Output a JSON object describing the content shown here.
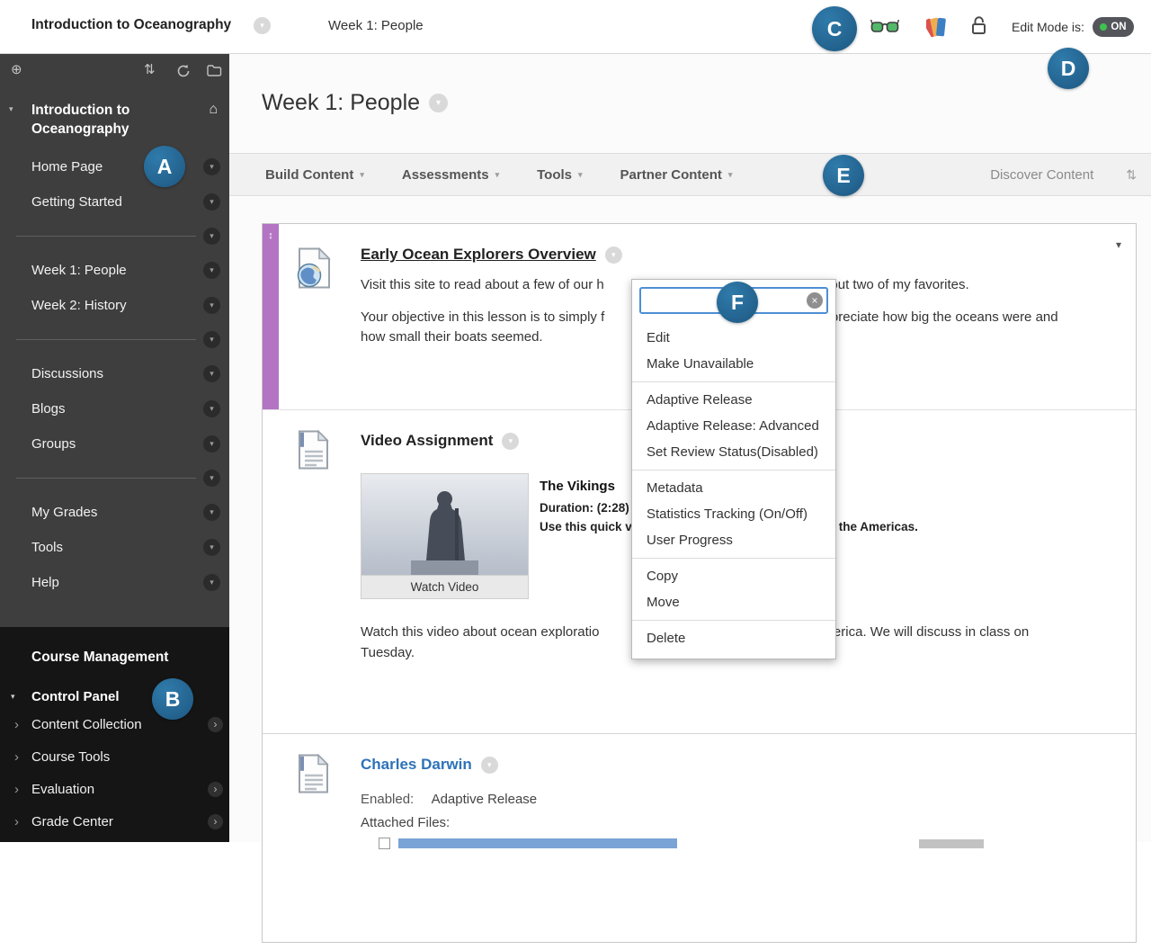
{
  "colors": {
    "annotation_badge": "#26658F",
    "selected_item_strip": "#B474C4",
    "edit_mode_on_green": "#3EC24E",
    "link_blue": "#2D72B8",
    "search_focus_border": "#4D8FD4",
    "sidebar_background": "#3E3E3E",
    "course_management_background": "#151515"
  },
  "icons": {
    "chevron_down": "▾",
    "chevron_right": "›",
    "home": "⌂",
    "move_handle": "↕",
    "add_circle": "⊕",
    "reorder": "⇅",
    "sort": "⇅",
    "clear": "×"
  },
  "annotations": {
    "a": "A",
    "b": "B",
    "c": "C",
    "d": "D",
    "e": "E",
    "f": "F"
  },
  "header": {
    "course_title": "Introduction to Oceanography",
    "breadcrumb": "Week 1: People",
    "edit_mode_label": "Edit Mode is:",
    "edit_mode_value": "ON"
  },
  "sidebar": {
    "course_title_line1": "Introduction to",
    "course_title_line2": "Oceanography",
    "items": [
      "Home Page",
      "Getting Started",
      "Week 1: People",
      "Week 2: History",
      "Discussions",
      "Blogs",
      "Groups",
      "My Grades",
      "Tools",
      "Help"
    ],
    "course_management": {
      "heading": "Course Management",
      "control_panel": "Control Panel",
      "items": [
        "Content Collection",
        "Course Tools",
        "Evaluation",
        "Grade Center"
      ]
    }
  },
  "main": {
    "page_title": "Week 1: People",
    "action_bar": {
      "menus": [
        "Build Content",
        "Assessments",
        "Tools",
        "Partner Content"
      ],
      "discover": "Discover Content"
    },
    "items": {
      "explorers": {
        "title": "Early Ocean Explorers Overview",
        "p1_left": "Visit this site to read about a few of our h",
        "p1_right": "about two of my favorites.",
        "p2_left": "Your objective in this lesson is to simply f",
        "p2_right": "appreciate how big the oceans were and how small their boats seemed."
      },
      "video": {
        "title": "Video Assignment",
        "video_title": "The Vikings",
        "duration": "Duration: (2:28)",
        "caption_left": "Use this quick v",
        "caption_right": "the Americas.",
        "watch_button": "Watch Video",
        "p_left": "Watch this video about ocean exploratio",
        "p_right": "merica. We will discuss in class on Tuesday."
      },
      "darwin": {
        "title": "Charles Darwin",
        "enabled_label": "Enabled:",
        "enabled_value": "Adaptive Release",
        "attached_label": "Attached Files:"
      }
    }
  },
  "context_menu": {
    "groups": [
      [
        "Edit",
        "Make Unavailable"
      ],
      [
        "Adaptive Release",
        "Adaptive Release: Advanced",
        "Set Review Status(Disabled)"
      ],
      [
        "Metadata",
        "Statistics Tracking (On/Off)",
        "User Progress"
      ],
      [
        "Copy",
        "Move"
      ],
      [
        "Delete"
      ]
    ]
  }
}
